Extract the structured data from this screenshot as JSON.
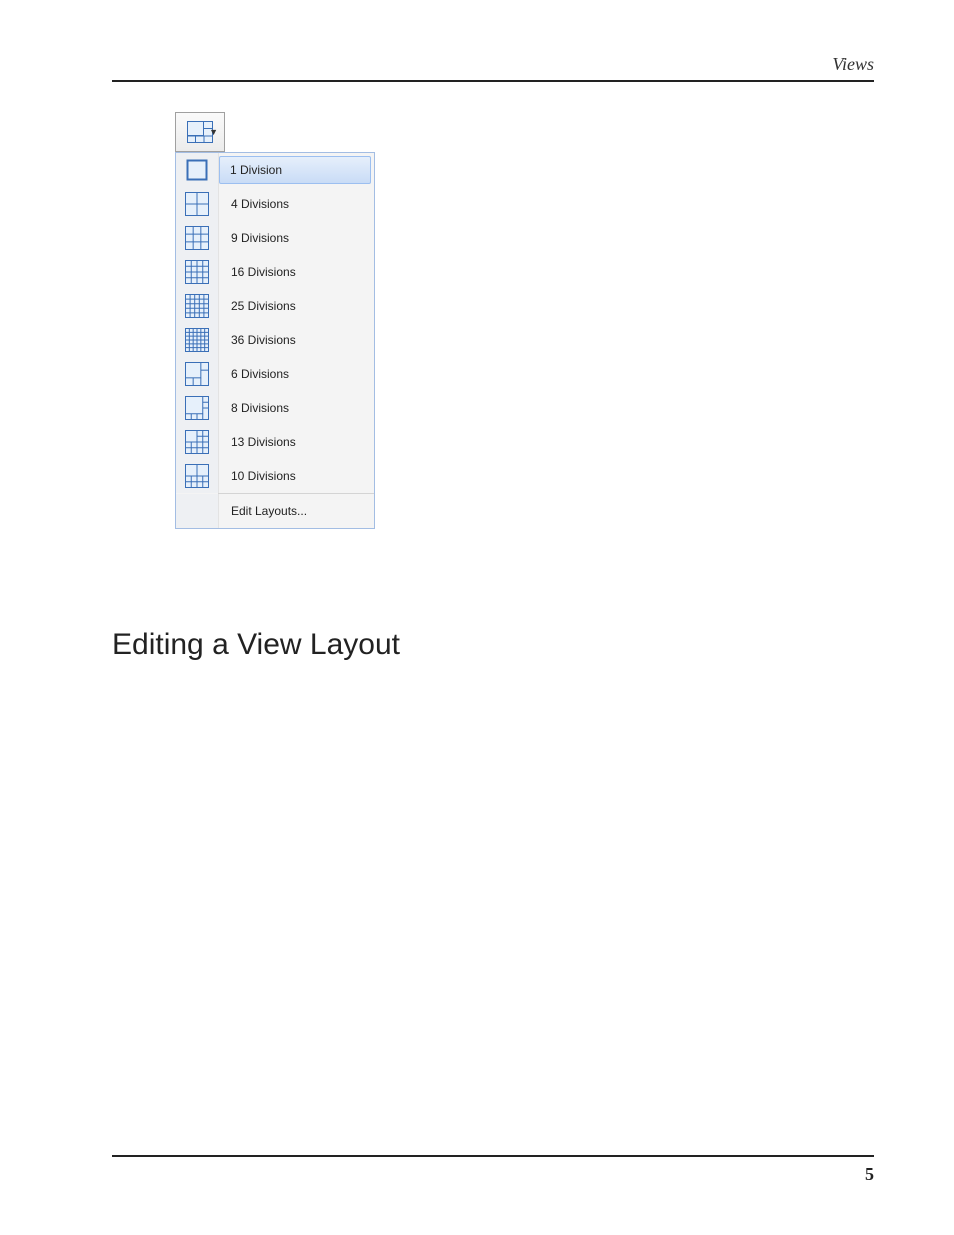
{
  "header": {
    "right_label": "Views"
  },
  "figure": {
    "toolbar_button": {
      "name": "layout-dropdown-button"
    },
    "menu": {
      "items": [
        {
          "label": "1 Division",
          "name": "menu-item-1-division",
          "selected": true,
          "icon": "grid-1"
        },
        {
          "label": "4 Divisions",
          "name": "menu-item-4-divisions",
          "selected": false,
          "icon": "grid-2x2"
        },
        {
          "label": "9 Divisions",
          "name": "menu-item-9-divisions",
          "selected": false,
          "icon": "grid-3x3"
        },
        {
          "label": "16 Divisions",
          "name": "menu-item-16-divisions",
          "selected": false,
          "icon": "grid-4x4"
        },
        {
          "label": "25 Divisions",
          "name": "menu-item-25-divisions",
          "selected": false,
          "icon": "grid-5x5"
        },
        {
          "label": "36 Divisions",
          "name": "menu-item-36-divisions",
          "selected": false,
          "icon": "grid-6x6"
        },
        {
          "label": "6 Divisions",
          "name": "menu-item-6-divisions",
          "selected": false,
          "icon": "layout-6"
        },
        {
          "label": "8 Divisions",
          "name": "menu-item-8-divisions",
          "selected": false,
          "icon": "layout-8"
        },
        {
          "label": "13 Divisions",
          "name": "menu-item-13-divisions",
          "selected": false,
          "icon": "layout-13"
        },
        {
          "label": "10 Divisions",
          "name": "menu-item-10-divisions",
          "selected": false,
          "icon": "layout-10"
        }
      ],
      "footer_item": {
        "label": "Edit Layouts...",
        "name": "menu-item-edit-layouts"
      }
    }
  },
  "section_heading": "Editing a View Layout",
  "page_number": "5"
}
